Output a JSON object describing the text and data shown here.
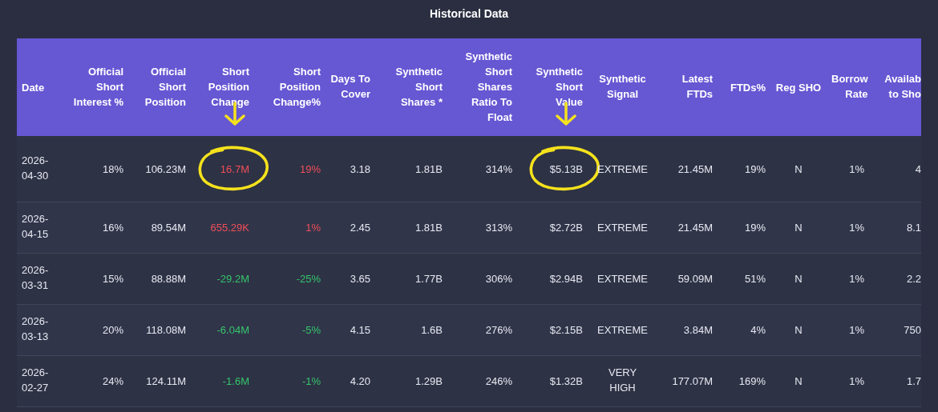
{
  "title": "Historical Data",
  "columns": [
    {
      "label": "Date",
      "kind": "date"
    },
    {
      "label": "Official Short Interest %",
      "kind": "number"
    },
    {
      "label": "Official Short Position",
      "kind": "number"
    },
    {
      "label": "Short Position Change",
      "kind": "number"
    },
    {
      "label": "Short Position Change%",
      "kind": "number"
    },
    {
      "label": "Days To Cover",
      "kind": "number"
    },
    {
      "label": "Synthetic Short Shares *",
      "kind": "number"
    },
    {
      "label": "Synthetic Short Shares Ratio To Float",
      "kind": "number"
    },
    {
      "label": "Synthetic Short Value",
      "kind": "number"
    },
    {
      "label": "Synthetic Signal",
      "kind": "flag"
    },
    {
      "label": "Latest FTDs",
      "kind": "number"
    },
    {
      "label": "FTDs%",
      "kind": "number"
    },
    {
      "label": "Reg SHO",
      "kind": "flag"
    },
    {
      "label": "Borrow Rate",
      "kind": "number"
    },
    {
      "label": "Availab to Sho",
      "kind": "number"
    }
  ],
  "rows": [
    {
      "cells": [
        {
          "text": "2026-04-30"
        },
        {
          "text": "18%"
        },
        {
          "text": "106.23M"
        },
        {
          "text": "16.7M",
          "color": "#ef4f58",
          "circled": true
        },
        {
          "text": "19%",
          "color": "#ef4f58"
        },
        {
          "text": "3.18"
        },
        {
          "text": "1.81B"
        },
        {
          "text": "314%"
        },
        {
          "text": "$5.13B",
          "circled": true
        },
        {
          "text": "EXTREME"
        },
        {
          "text": "21.45M"
        },
        {
          "text": "19%"
        },
        {
          "text": "N"
        },
        {
          "text": "1%"
        },
        {
          "text": "4"
        }
      ]
    },
    {
      "cells": [
        {
          "text": "2026-04-15"
        },
        {
          "text": "16%"
        },
        {
          "text": "89.54M"
        },
        {
          "text": "655.29K",
          "color": "#ef4f58"
        },
        {
          "text": "1%",
          "color": "#ef4f58"
        },
        {
          "text": "2.45"
        },
        {
          "text": "1.81B"
        },
        {
          "text": "313%"
        },
        {
          "text": "$2.72B"
        },
        {
          "text": "EXTREME"
        },
        {
          "text": "21.45M"
        },
        {
          "text": "19%"
        },
        {
          "text": "N"
        },
        {
          "text": "1%"
        },
        {
          "text": "8.1"
        }
      ]
    },
    {
      "cells": [
        {
          "text": "2026-03-31"
        },
        {
          "text": "15%"
        },
        {
          "text": "88.88M"
        },
        {
          "text": "-29.2M",
          "color": "#33c56a"
        },
        {
          "text": "-25%",
          "color": "#33c56a"
        },
        {
          "text": "3.65"
        },
        {
          "text": "1.77B"
        },
        {
          "text": "306%"
        },
        {
          "text": "$2.94B"
        },
        {
          "text": "EXTREME"
        },
        {
          "text": "59.09M"
        },
        {
          "text": "51%"
        },
        {
          "text": "N"
        },
        {
          "text": "1%"
        },
        {
          "text": "2.2"
        }
      ]
    },
    {
      "cells": [
        {
          "text": "2026-03-13"
        },
        {
          "text": "20%"
        },
        {
          "text": "118.08M"
        },
        {
          "text": "-6.04M",
          "color": "#33c56a"
        },
        {
          "text": "-5%",
          "color": "#33c56a"
        },
        {
          "text": "4.15"
        },
        {
          "text": "1.6B"
        },
        {
          "text": "276%"
        },
        {
          "text": "$2.15B"
        },
        {
          "text": "EXTREME"
        },
        {
          "text": "3.84M"
        },
        {
          "text": "4%"
        },
        {
          "text": "N"
        },
        {
          "text": "1%"
        },
        {
          "text": "750"
        }
      ]
    },
    {
      "cells": [
        {
          "text": "2026-02-27"
        },
        {
          "text": "24%"
        },
        {
          "text": "124.11M"
        },
        {
          "text": "-1.6M",
          "color": "#33c56a"
        },
        {
          "text": "-1%",
          "color": "#33c56a"
        },
        {
          "text": "4.20"
        },
        {
          "text": "1.29B"
        },
        {
          "text": "246%"
        },
        {
          "text": "$1.32B"
        },
        {
          "text": "VERY HIGH"
        },
        {
          "text": "177.07M"
        },
        {
          "text": "169%"
        },
        {
          "text": "N"
        },
        {
          "text": "1%"
        },
        {
          "text": "1.7"
        }
      ]
    }
  ]
}
